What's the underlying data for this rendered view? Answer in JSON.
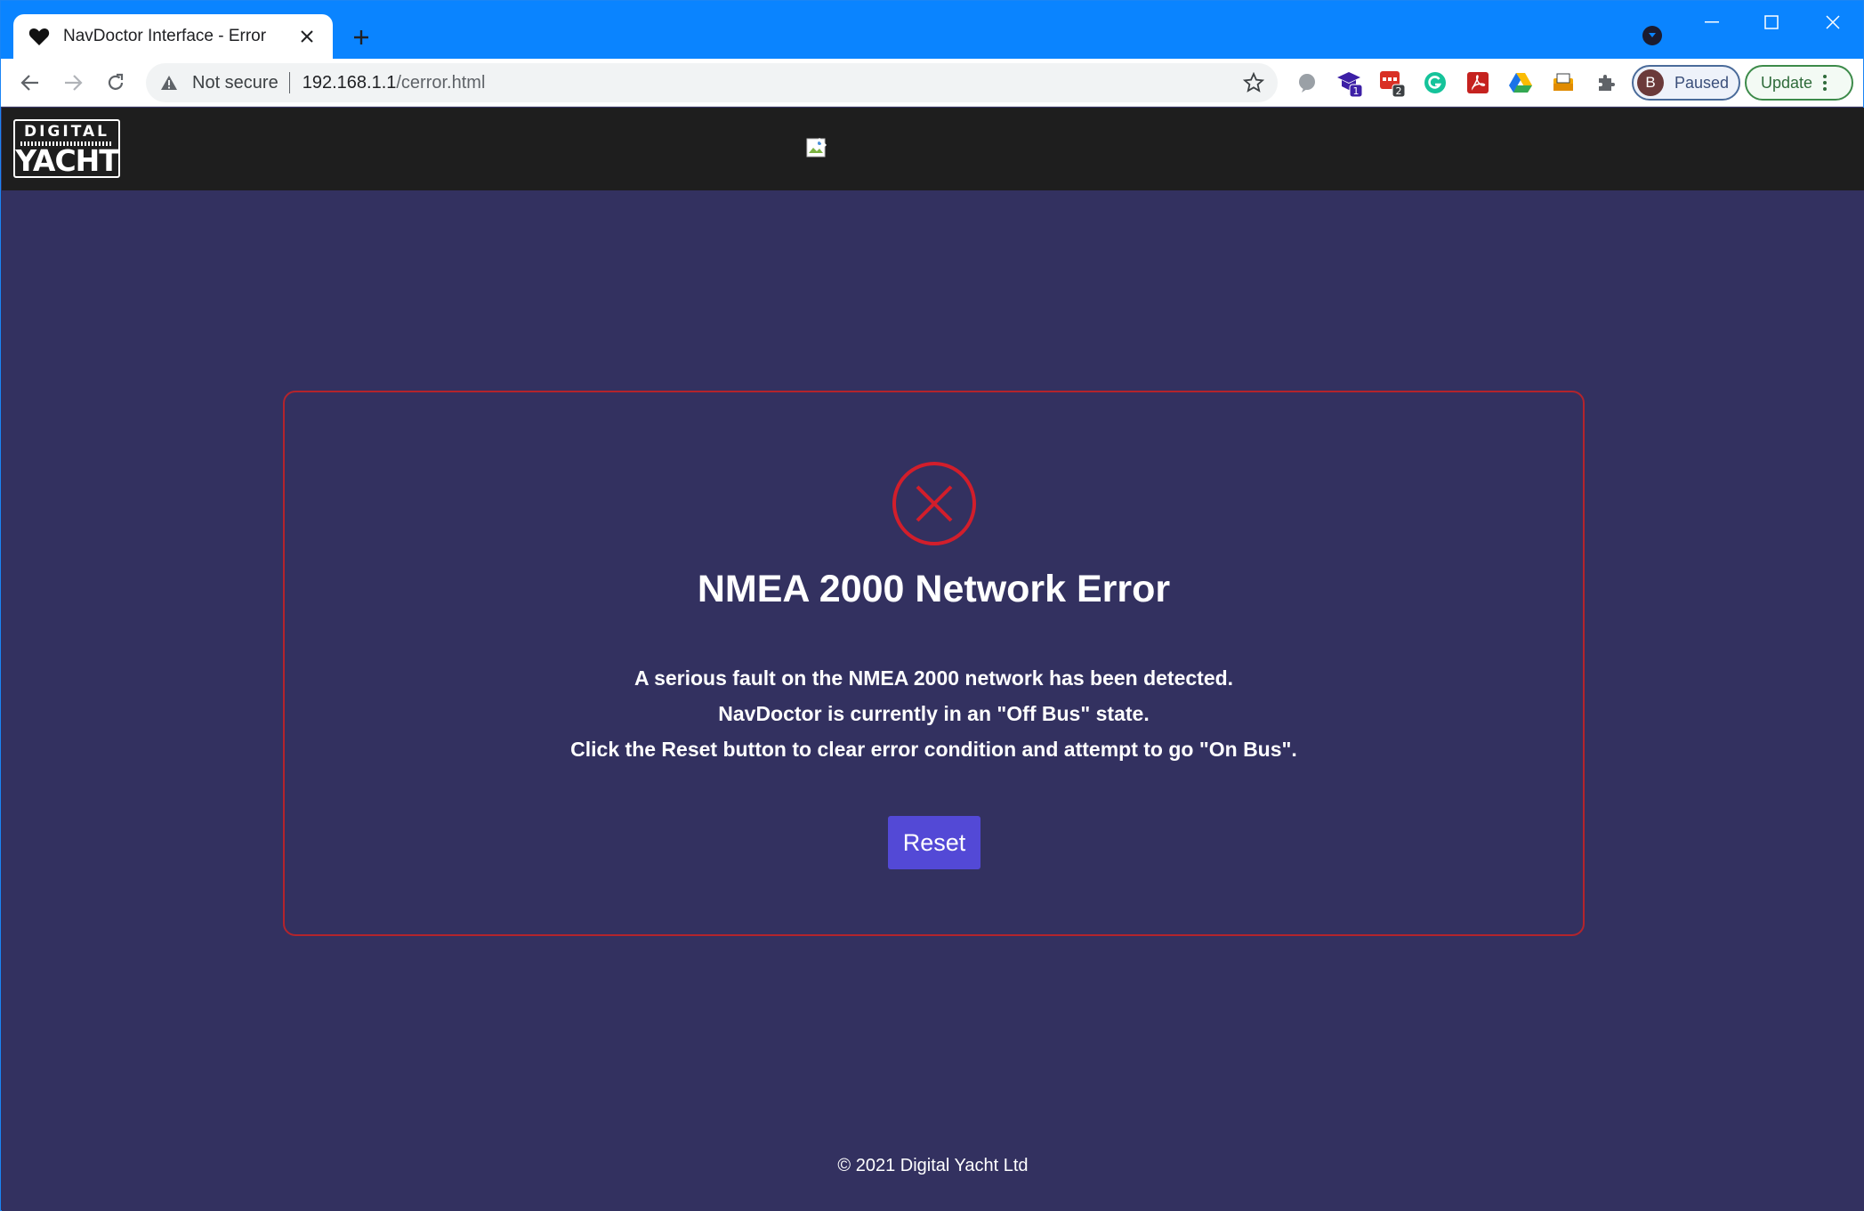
{
  "browser": {
    "tab_title": "NavDoctor Interface - Error",
    "security_label": "Not secure",
    "url_host": "192.168.1.1",
    "url_path": "/cerror.html",
    "profile_initial": "B",
    "profile_status": "Paused",
    "update_label": "Update",
    "extension_badges": {
      "ext2": "1",
      "ext3": "2"
    }
  },
  "header": {
    "logo_top": "DIGITAL",
    "logo_bottom": "YACHT"
  },
  "error": {
    "title": "NMEA 2000 Network Error",
    "line1": "A serious fault on the NMEA 2000 network has been detected.",
    "line2": "NavDoctor is currently in an \"Off Bus\" state.",
    "line3": "Click the Reset button to clear error condition and attempt to go \"On Bus\".",
    "reset_label": "Reset",
    "accent_color": "#b3242c",
    "button_color": "#5349d6"
  },
  "footer": {
    "copyright": "© 2021 Digital Yacht Ltd"
  }
}
